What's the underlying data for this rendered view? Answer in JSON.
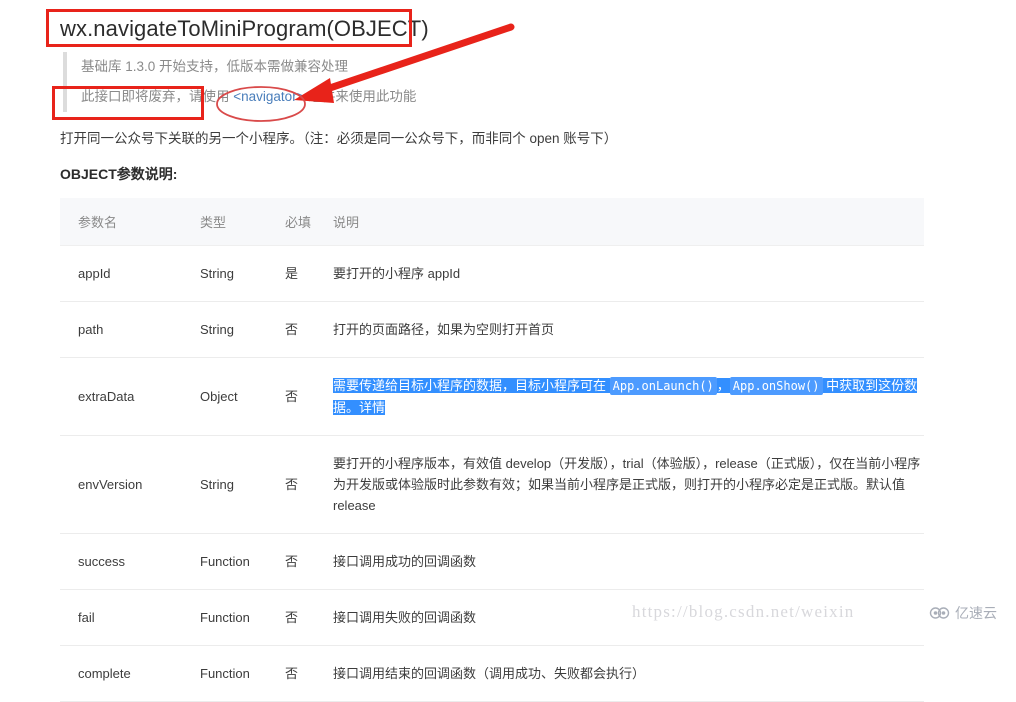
{
  "page": {
    "title": "wx.navigateToMiniProgram(OBJECT)",
    "notes": [
      "基础库 1.3.0 开始支持，低版本需做兼容处理",
      "此接口即将废弃，请使用 <navigator> 组件来使用此功能"
    ],
    "note_link_label": "<navigator>",
    "note2_prefix": "此接口即将废弃，请使用 ",
    "note2_suffix": " 组件来使用此功能",
    "intro": "打开同一公众号下关联的另一个小程序。（注：必须是同一公众号下，而非同个 open 账号下）",
    "section_heading": "OBJECT参数说明:"
  },
  "table": {
    "columns": [
      "参数名",
      "类型",
      "必填",
      "说明"
    ],
    "rows": [
      {
        "name": "appId",
        "type": "String",
        "required": "是",
        "desc": "要打开的小程序 appId"
      },
      {
        "name": "path",
        "type": "String",
        "required": "否",
        "desc": "打开的页面路径，如果为空则打开首页"
      },
      {
        "name": "extraData",
        "type": "Object",
        "required": "否",
        "desc_part1": "需要传递给目标小程序的数据，目标小程序可在 ",
        "desc_code1": "App.onLaunch()",
        "desc_sep": "，",
        "desc_code2": "App.onShow()",
        "desc_part2": " 中获取到这份数据。详情",
        "selected": true
      },
      {
        "name": "envVersion",
        "type": "String",
        "required": "否",
        "desc": "要打开的小程序版本，有效值 develop（开发版），trial（体验版），release（正式版），仅在当前小程序为开发版或体验版时此参数有效；如果当前小程序是正式版，则打开的小程序必定是正式版。默认值 release"
      },
      {
        "name": "success",
        "type": "Function",
        "required": "否",
        "desc": "接口调用成功的回调函数"
      },
      {
        "name": "fail",
        "type": "Function",
        "required": "否",
        "desc": "接口调用失败的回调函数"
      },
      {
        "name": "complete",
        "type": "Function",
        "required": "否",
        "desc": "接口调用结束的回调函数（调用成功、失败都会执行）"
      }
    ]
  },
  "annotations": {
    "color": "#e8231a",
    "title_box": "red-rectangle-around-title",
    "deprecated_box": "red-rectangle-around-deprecation-note",
    "arrow": "red-arrow-pointing-to-navigator",
    "ellipse": "red-ellipse-around-navigator-link"
  },
  "watermark": {
    "url": "https://blog.csdn.net/weixin",
    "brand": "亿速云"
  }
}
